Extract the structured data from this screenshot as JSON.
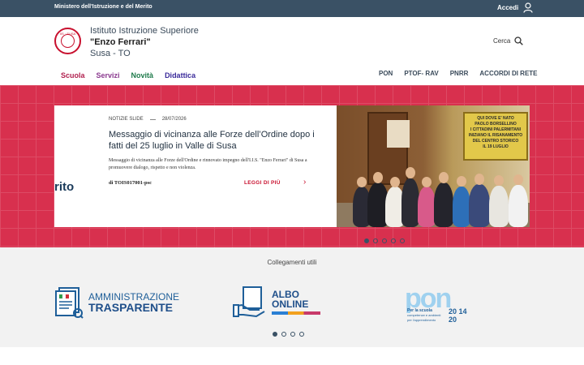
{
  "topbar": {
    "ministry": "Ministero dell'Istruzione e del Merito",
    "login_label": "Accedi"
  },
  "header": {
    "school_line1": "Istituto Istruzione Superiore",
    "school_line2": "\"Enzo Ferrari\"",
    "school_line3": "Susa - TO",
    "logo_text": "IIS Enzo Ferrari Susa",
    "search_label": "Cerca"
  },
  "main_nav": [
    {
      "label": "Scuola",
      "color": "#b1214f"
    },
    {
      "label": "Servizi",
      "color": "#8b3a8f"
    },
    {
      "label": "Novità",
      "color": "#1e7a4a"
    },
    {
      "label": "Didattica",
      "color": "#3a2a9a"
    }
  ],
  "sub_nav": [
    "PON",
    "PTOF- RAV",
    "PNRR",
    "ACCORDI DI RETE"
  ],
  "hero": {
    "accent_color": "#d8304e",
    "side_fragment": "rito",
    "category": "NOTIZIE SLIDE",
    "date": "28/07/2026",
    "title": "Messaggio di vicinanza alle Forze dell’Ordine dopo i fatti del 25 luglio in Valle di Susa",
    "excerpt": "Messaggio di vicinanza alle Forze dell'Ordine e rinnovato impegno dell'I.I.S. \"Enzo Ferrari\" di Susa a promuovere dialogo, rispetto e non violenza.",
    "author": "di TOIS017001-psc",
    "read_more": "LEGGI DI PIÙ",
    "plaque_lines": [
      "QUI DOVE E' NATO",
      "PAOLO BORSELLINO",
      "I CITTADINI PALERMITANI",
      "INIZIANO IL RISANAMENTO",
      "DEL CENTRO STORICO",
      "IL 19 LUGLIO"
    ],
    "slide_count": 5,
    "active_slide": 0
  },
  "useful_links": {
    "title": "Collegamenti utili",
    "at_line1": "AMMINISTRAZIONE",
    "at_line2": "TRASPARENTE",
    "albo_line1": "ALBO",
    "albo_line2": "ONLINE",
    "pon_letters": "pon",
    "pon_sub_line1": "Per la scuola",
    "pon_sub_line2": "competenze e ambienti per l'apprendimento",
    "pon_year": "20 14 20",
    "slide_count": 4,
    "active_slide": 0
  }
}
